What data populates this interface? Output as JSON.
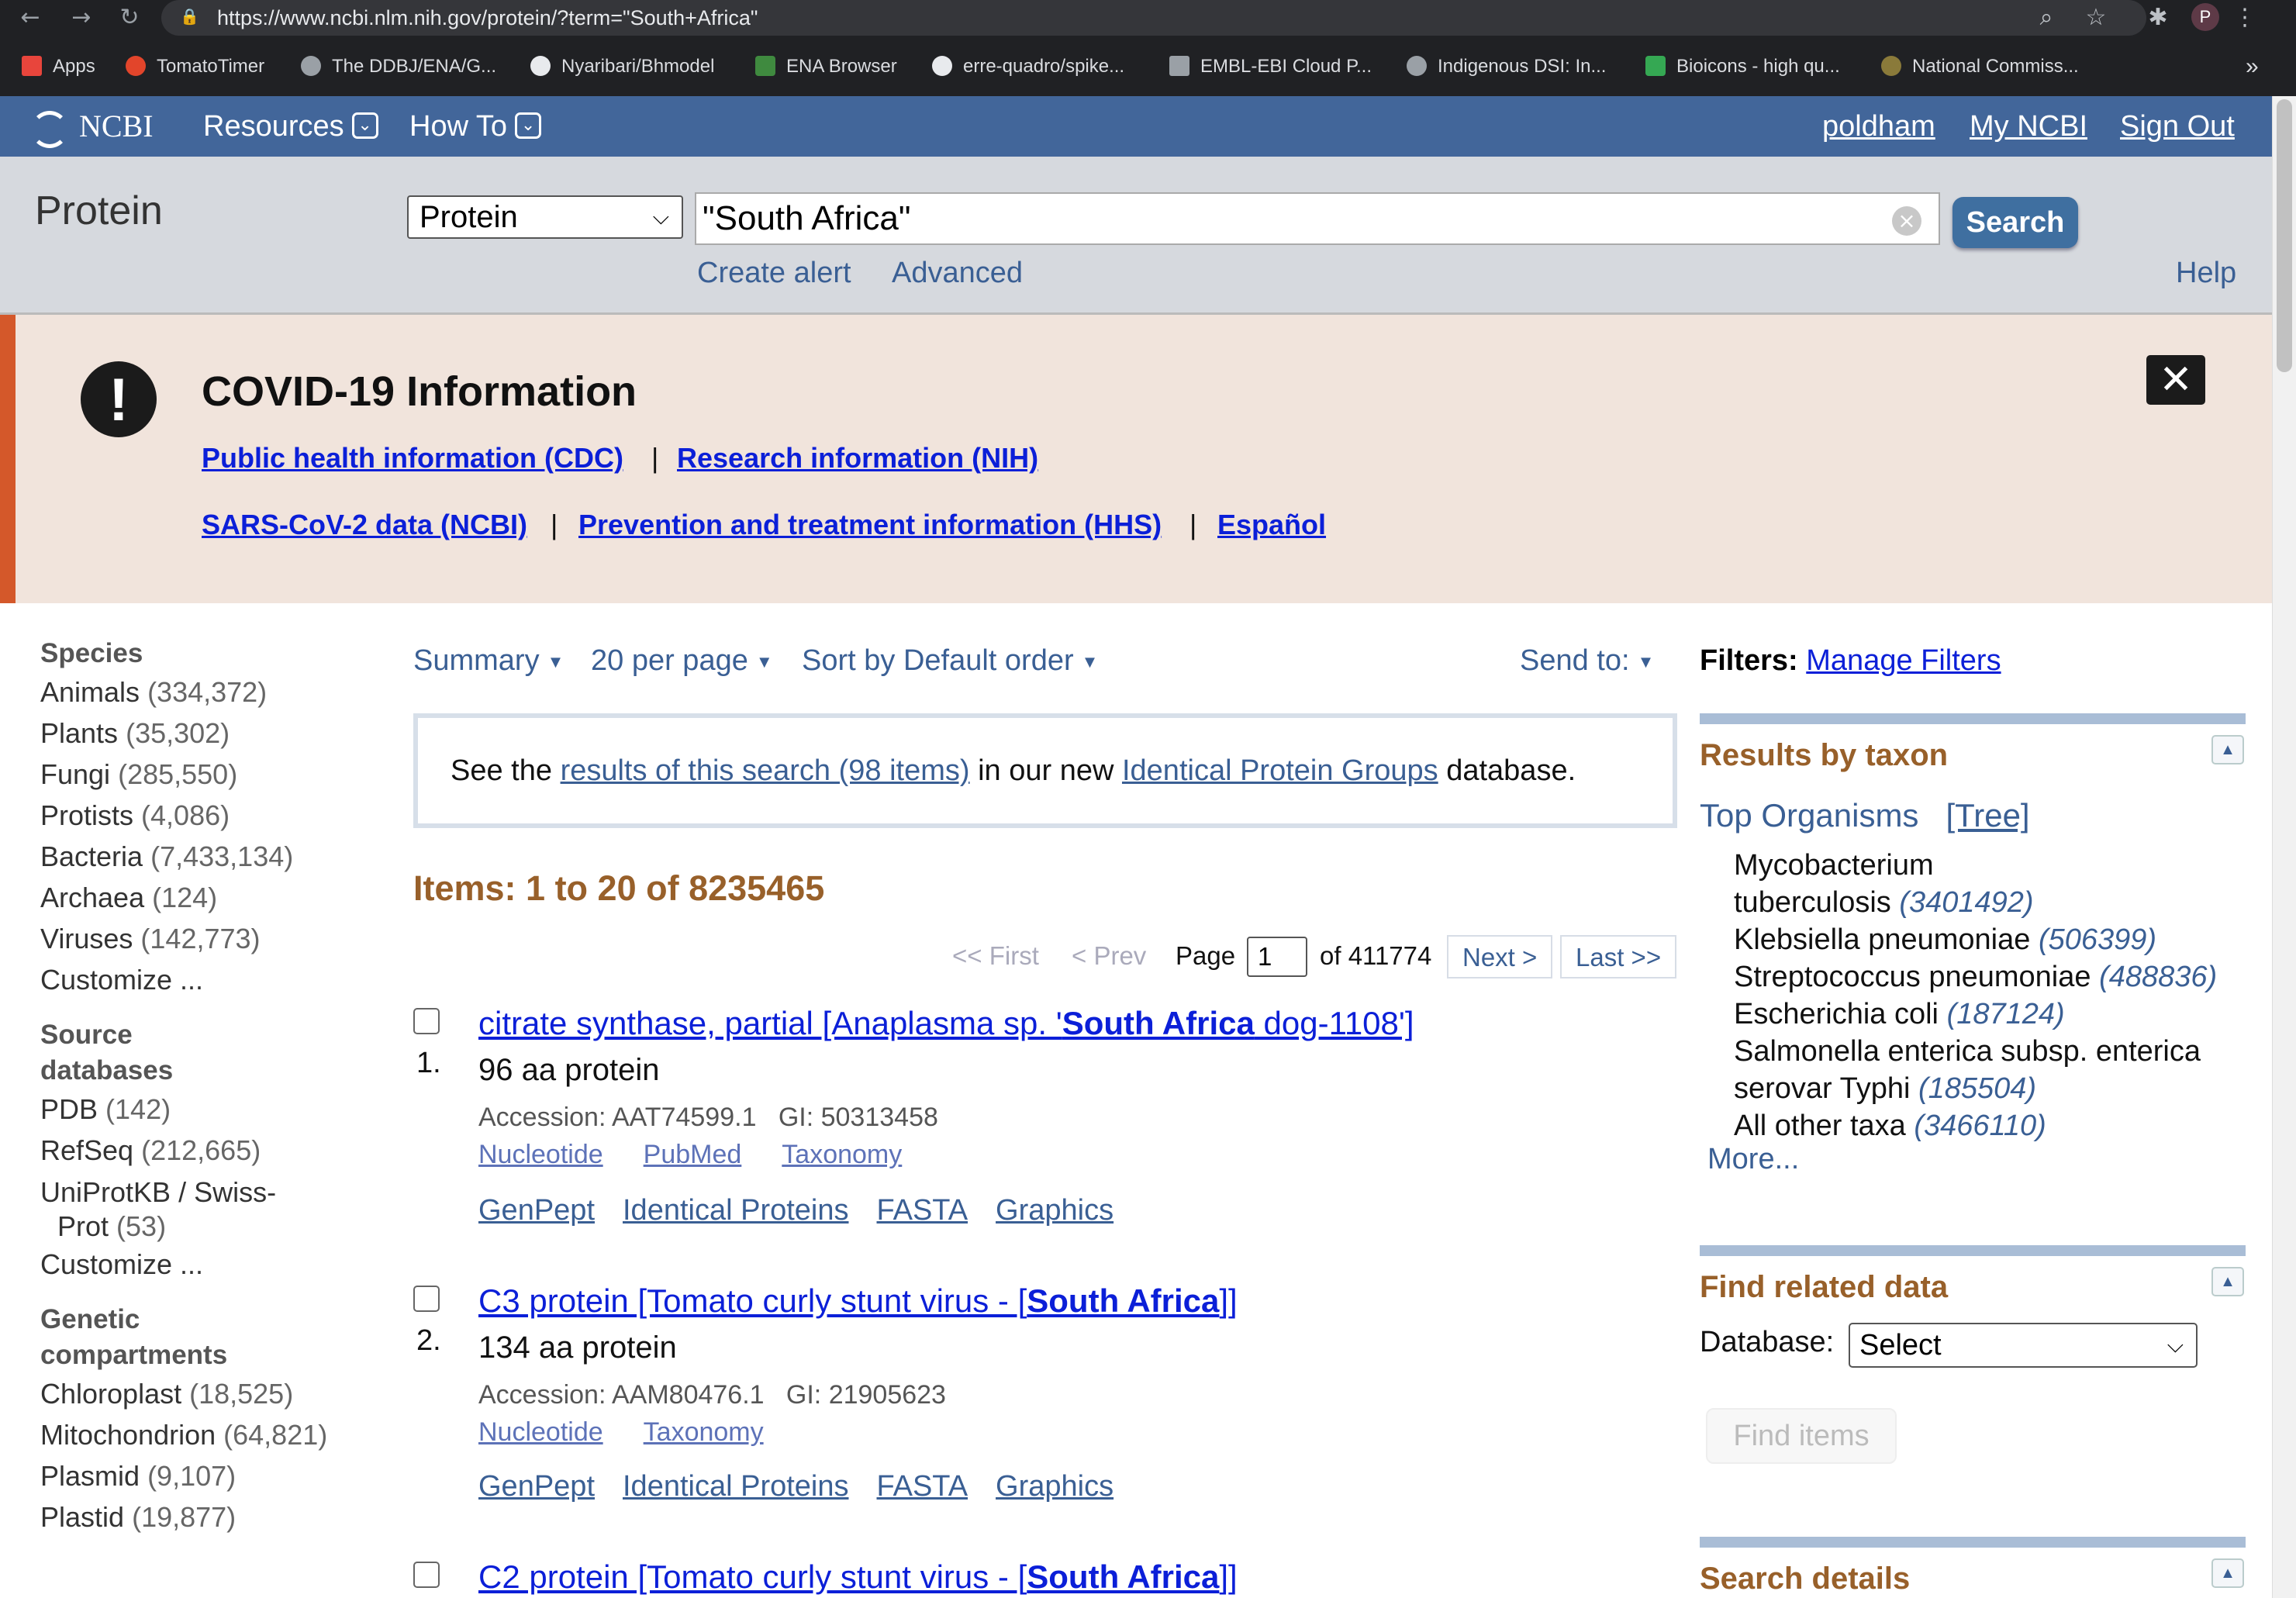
{
  "browser": {
    "url": "https://www.ncbi.nlm.nih.gov/protein/?term=\"South+Africa\"",
    "avatar_letter": "P",
    "bookmarks": [
      "Apps",
      "TomatoTimer",
      "The DDBJ/ENA/G...",
      "Nyaribari/Bhmodel",
      "ENA Browser",
      "erre-quadro/spike...",
      "EMBL-EBI Cloud P...",
      "Indigenous DSI: In...",
      "Bioicons - high qu...",
      "National Commiss..."
    ],
    "more": "»"
  },
  "header": {
    "logo": "NCBI",
    "resources": "Resources",
    "howto": "How To",
    "user": "poldham",
    "myncbi": "My NCBI",
    "signout": "Sign Out"
  },
  "search": {
    "db_title": "Protein",
    "db_select": "Protein",
    "term": "\"South Africa\"",
    "button": "Search",
    "create_alert": "Create alert",
    "advanced": "Advanced",
    "help": "Help"
  },
  "covid": {
    "title": "COVID-19 Information",
    "links": [
      "Public health information (CDC)",
      "Research information (NIH)",
      "SARS-CoV-2 data (NCBI)",
      "Prevention and treatment information (HHS)",
      "Español"
    ],
    "sep": "|"
  },
  "facets": {
    "species_title": "Species",
    "species": [
      {
        "label": "Animals",
        "count": "(334,372)"
      },
      {
        "label": "Plants",
        "count": "(35,302)"
      },
      {
        "label": "Fungi",
        "count": "(285,550)"
      },
      {
        "label": "Protists",
        "count": "(4,086)"
      },
      {
        "label": "Bacteria",
        "count": "(7,433,134)"
      },
      {
        "label": "Archaea",
        "count": "(124)"
      },
      {
        "label": "Viruses",
        "count": "(142,773)"
      }
    ],
    "customize": "Customize ...",
    "source_title_1": "Source",
    "source_title_2": "databases",
    "sources": [
      {
        "label": "PDB",
        "count": "(142)"
      },
      {
        "label": "RefSeq",
        "count": "(212,665)"
      }
    ],
    "uniprot_1": "UniProtKB / Swiss-",
    "uniprot_2": "Prot",
    "uniprot_count": "(53)",
    "genetic_title_1": "Genetic",
    "genetic_title_2": "compartments",
    "genetic": [
      {
        "label": "Chloroplast",
        "count": "(18,525)"
      },
      {
        "label": "Mitochondrion",
        "count": "(64,821)"
      },
      {
        "label": "Plasmid",
        "count": "(9,107)"
      },
      {
        "label": "Plastid",
        "count": "(19,877)"
      }
    ]
  },
  "toolbar": {
    "summary": "Summary",
    "perpage": "20 per page",
    "sort": "Sort by Default order",
    "sendto": "Send to:"
  },
  "ipg": {
    "pre": "See the ",
    "link": "results of this search (98 items)",
    "mid": " in our new ",
    "link2": "Identical Protein Groups",
    "post": " database."
  },
  "items_label": "Items: 1 to 20 of 8235465",
  "pager": {
    "first": "<< First",
    "prev": "< Prev",
    "page_label": "Page",
    "page": "1",
    "of": "of 411774",
    "next": "Next >",
    "last": "Last >>"
  },
  "results": [
    {
      "num": "1.",
      "title_pre": "citrate synthase, partial [Anaplasma sp. '",
      "title_bold": "South Africa",
      "title_post": " dog-1108']",
      "desc": "96 aa protein",
      "accession": "Accession: AAT74599.1",
      "gi": "GI: 50313458",
      "links1": [
        "Nucleotide",
        "PubMed",
        "Taxonomy"
      ],
      "links2": [
        "GenPept",
        "Identical Proteins",
        "FASTA",
        "Graphics"
      ]
    },
    {
      "num": "2.",
      "title_pre": "C3 protein [Tomato curly stunt virus - [",
      "title_bold": "South Africa",
      "title_post": "]]",
      "desc": "134 aa protein",
      "accession": "Accession: AAM80476.1",
      "gi": "GI: 21905623",
      "links1": [
        "Nucleotide",
        "Taxonomy"
      ],
      "links2": [
        "GenPept",
        "Identical Proteins",
        "FASTA",
        "Graphics"
      ]
    },
    {
      "title_pre": "C2 protein [Tomato curly stunt virus - [",
      "title_bold": "South Africa",
      "title_post": "]]"
    }
  ],
  "sidebar": {
    "filters": "Filters:",
    "manage": "Manage Filters",
    "taxon_title": "Results by taxon",
    "top_organisms": "Top Organisms",
    "tree": "[Tree]",
    "organisms": [
      {
        "l1": "Mycobacterium",
        "l2": "tuberculosis",
        "count": "(3401492)"
      },
      {
        "l1": "Klebsiella pneumoniae",
        "count": "(506399)"
      },
      {
        "l1": "Streptococcus pneumoniae",
        "count": "(488836)"
      },
      {
        "l1": "Escherichia coli",
        "count": "(187124)"
      },
      {
        "l1": "Salmonella enterica subsp. enterica",
        "l2": "serovar Typhi",
        "count": "(185504)"
      },
      {
        "l1": "All other taxa",
        "count": "(3466110)"
      }
    ],
    "more": "More...",
    "related_title": "Find related data",
    "database_label": "Database:",
    "database_value": "Select",
    "find_items": "Find items",
    "details_title": "Search details"
  }
}
